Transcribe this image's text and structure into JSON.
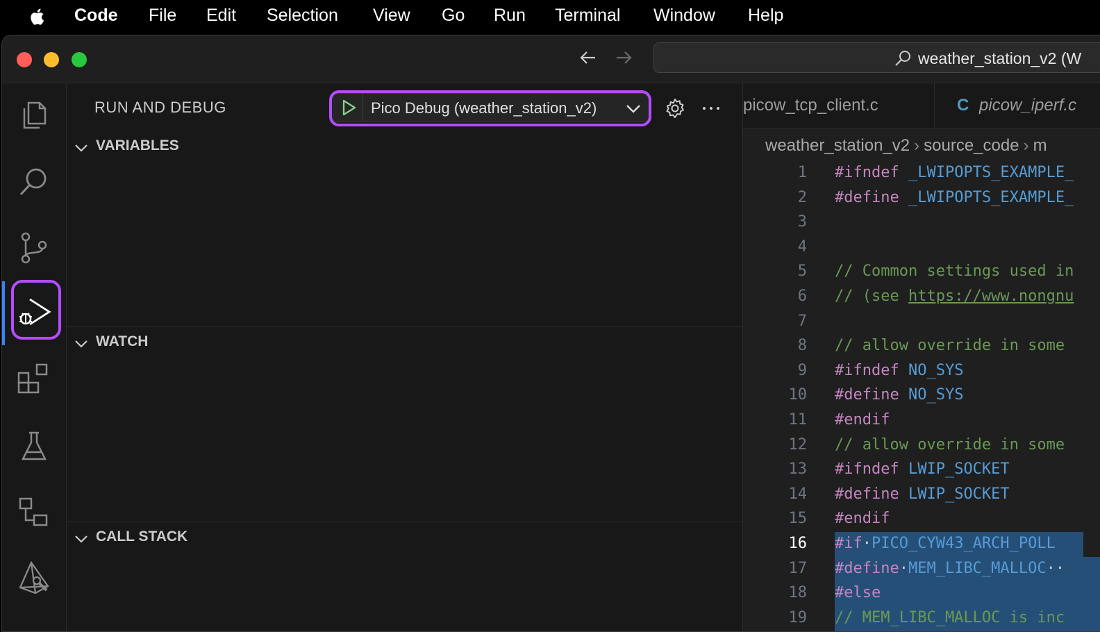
{
  "menubar": {
    "app": "Code",
    "items": [
      "File",
      "Edit",
      "Selection",
      "View",
      "Go",
      "Run",
      "Terminal",
      "Window",
      "Help"
    ]
  },
  "titlebar": {
    "command_center": "weather_station_v2 (W",
    "icons": [
      "back-arrow-icon",
      "forward-arrow-icon",
      "search-icon"
    ]
  },
  "activity_bar": {
    "items": [
      "explorer-icon",
      "search-icon",
      "source-control-icon",
      "run-debug-icon",
      "extensions-icon",
      "testing-icon",
      "remote-explorer-icon",
      "pico-icon"
    ],
    "active": "run-debug-icon",
    "accent": "#b34dff"
  },
  "sidebar": {
    "title": "RUN AND DEBUG",
    "launch_config": "Pico Debug (weather_station_v2)",
    "sections": [
      "VARIABLES",
      "WATCH",
      "CALL STACK"
    ]
  },
  "editor": {
    "tabs": [
      {
        "label": "picow_tcp_client.c",
        "icon": ""
      },
      {
        "label": "picow_iperf.c",
        "icon": "C"
      }
    ],
    "breadcrumb": [
      "weather_station_v2",
      "source_code",
      "m"
    ],
    "current_line": 16,
    "lines": [
      {
        "n": "1",
        "parts": [
          [
            "kw",
            "#ifndef"
          ],
          [
            "",
            " "
          ],
          [
            "mac",
            "_LWIPOPTS_EXAMPLE_"
          ]
        ]
      },
      {
        "n": "2",
        "parts": [
          [
            "kw",
            "#define"
          ],
          [
            "",
            " "
          ],
          [
            "mac",
            "_LWIPOPTS_EXAMPLE_"
          ]
        ]
      },
      {
        "n": "3",
        "parts": []
      },
      {
        "n": "4",
        "parts": []
      },
      {
        "n": "5",
        "parts": [
          [
            "cm",
            "// Common settings used in"
          ]
        ]
      },
      {
        "n": "6",
        "parts": [
          [
            "cm",
            "// (see "
          ],
          [
            "url",
            "https://www.nongnu"
          ]
        ]
      },
      {
        "n": "7",
        "parts": []
      },
      {
        "n": "8",
        "parts": [
          [
            "cm",
            "// allow override in some"
          ]
        ]
      },
      {
        "n": "9",
        "parts": [
          [
            "kw",
            "#ifndef"
          ],
          [
            "",
            " "
          ],
          [
            "mac",
            "NO_SYS"
          ]
        ]
      },
      {
        "n": "10",
        "parts": [
          [
            "kw",
            "#define"
          ],
          [
            "",
            " "
          ],
          [
            "mac",
            "NO_SYS"
          ]
        ]
      },
      {
        "n": "11",
        "parts": [
          [
            "kw",
            "#endif"
          ]
        ]
      },
      {
        "n": "12",
        "parts": [
          [
            "cm",
            "// allow override in some"
          ]
        ]
      },
      {
        "n": "13",
        "parts": [
          [
            "kw",
            "#ifndef"
          ],
          [
            "",
            " "
          ],
          [
            "mac",
            "LWIP_SOCKET"
          ]
        ]
      },
      {
        "n": "14",
        "parts": [
          [
            "kw",
            "#define"
          ],
          [
            "",
            " "
          ],
          [
            "mac",
            "LWIP_SOCKET"
          ]
        ]
      },
      {
        "n": "15",
        "parts": [
          [
            "kw",
            "#endif"
          ]
        ]
      },
      {
        "n": "16",
        "parts": [
          [
            "kw",
            "#if"
          ],
          [
            "",
            "·"
          ],
          [
            "mac",
            "PICO_CYW43_ARCH_POLL"
          ]
        ],
        "sel": 358
      },
      {
        "n": "17",
        "parts": [
          [
            "kw",
            "#define"
          ],
          [
            "",
            "·"
          ],
          [
            "mac",
            "MEM_LIBC_MALLOC"
          ],
          [
            "",
            "··"
          ]
        ],
        "sel": 400
      },
      {
        "n": "18",
        "parts": [
          [
            "kw",
            "#else"
          ]
        ],
        "sel": 400
      },
      {
        "n": "19",
        "parts": [
          [
            "cm",
            "// MEM_LIBC_MALLOC is inc"
          ]
        ],
        "sel": 400
      }
    ]
  }
}
